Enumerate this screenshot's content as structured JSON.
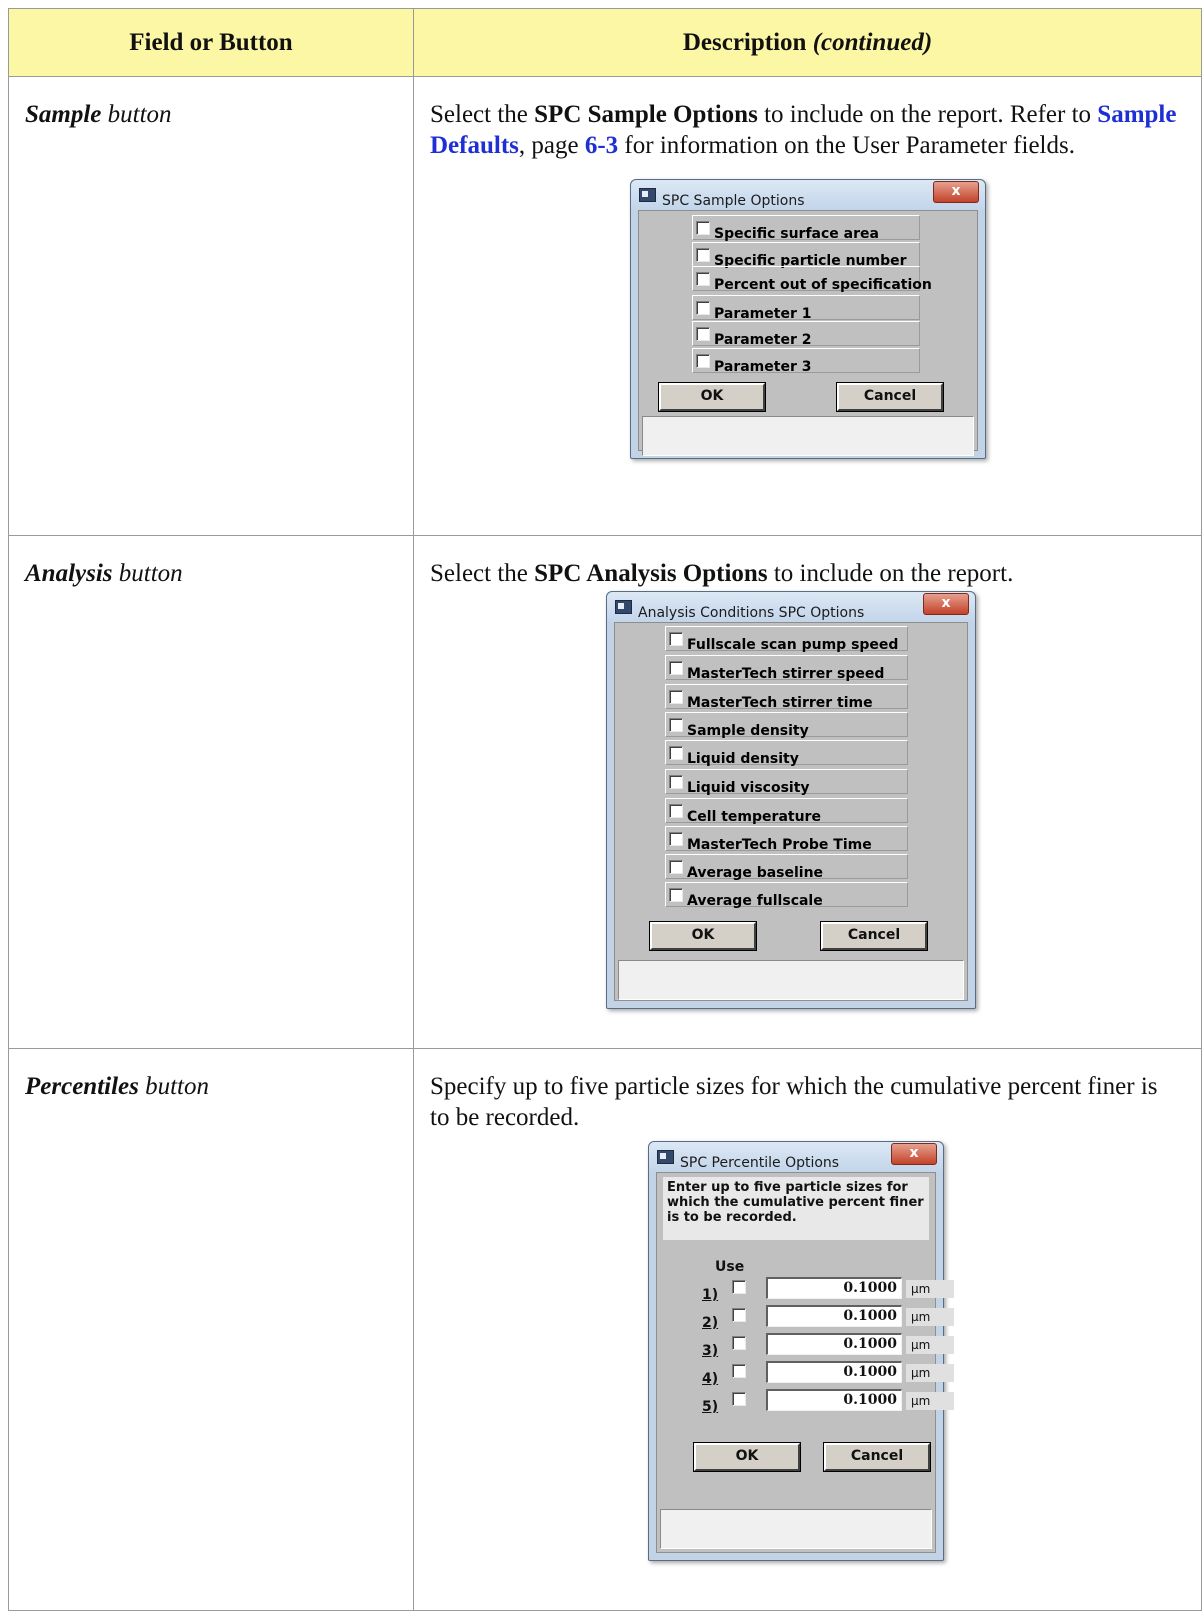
{
  "header": {
    "col1": "Field or Button",
    "col2_main": "Description ",
    "col2_cont": "(continued)"
  },
  "rows": [
    {
      "field_bold": "Sample",
      "field_rest": " button",
      "desc_pre": "Select the ",
      "desc_bold": "SPC Sample Options",
      "desc_post": " to include on the report. Refer to ",
      "link1": "Sample Defaults",
      "desc_mid": ", page ",
      "link2": "6-3",
      "desc_end": " for information on the User Parameter fields.",
      "dialog": {
        "title": "SPC Sample Options",
        "close": "x",
        "options": [
          "Specific surface area",
          "Specific particle number",
          "Percent out of specification",
          "Parameter 1",
          "Parameter 2",
          "Parameter 3"
        ],
        "ok": "OK",
        "cancel": "Cancel"
      }
    },
    {
      "field_bold": "Analysis",
      "field_rest": " button",
      "desc_pre": "Select the ",
      "desc_bold": "SPC Analysis Options",
      "desc_post": " to include on the report.",
      "dialog": {
        "title": "Analysis Conditions SPC Options",
        "close": "x",
        "options": [
          "Fullscale scan pump speed",
          "MasterTech stirrer speed",
          "MasterTech stirrer time",
          "Sample density",
          "Liquid density",
          "Liquid viscosity",
          "Cell temperature",
          "MasterTech Probe Time",
          "Average baseline",
          "Average fullscale"
        ],
        "ok": "OK",
        "cancel": "Cancel"
      }
    },
    {
      "field_bold": "Percentiles",
      "field_rest": " button",
      "desc": "Specify up to five particle sizes for which the cumulative percent finer is to be recorded.",
      "dialog": {
        "title": "SPC Percentile Options",
        "close": "x",
        "instructions": "Enter up to five particle sizes for which the cumulative percent finer is to be recorded.",
        "use_label": "Use",
        "rows": [
          {
            "num": "1)",
            "value": "0.1000",
            "unit": "µm"
          },
          {
            "num": "2)",
            "value": "0.1000",
            "unit": "µm"
          },
          {
            "num": "3)",
            "value": "0.1000",
            "unit": "µm"
          },
          {
            "num": "4)",
            "value": "0.1000",
            "unit": "µm"
          },
          {
            "num": "5)",
            "value": "0.1000",
            "unit": "µm"
          }
        ],
        "ok": "OK",
        "cancel": "Cancel"
      }
    }
  ]
}
